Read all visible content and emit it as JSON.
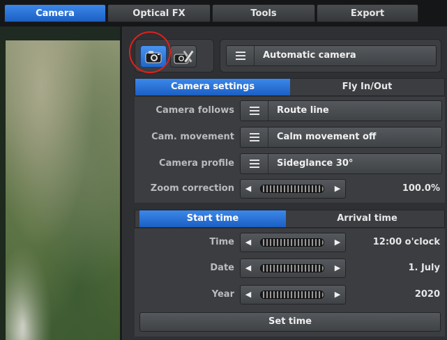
{
  "tabs": [
    {
      "label": "Camera",
      "active": true
    },
    {
      "label": "Optical FX",
      "active": false
    },
    {
      "label": "Tools",
      "active": false
    },
    {
      "label": "Export",
      "active": false
    }
  ],
  "mode_buttons": {
    "camera": {
      "icon": "camera-icon",
      "active": true
    },
    "camera_tool": {
      "icon": "camera-settings-icon",
      "active": false
    }
  },
  "automatic_camera": {
    "icon": "menu-list-icon",
    "label": "Automatic camera"
  },
  "camera_tabs": [
    {
      "label": "Camera settings",
      "active": true
    },
    {
      "label": "Fly In/Out",
      "active": false
    }
  ],
  "camera_settings": {
    "follows_label": "Camera follows",
    "follows_value": "Route line",
    "movement_label": "Cam. movement",
    "movement_value": "Calm movement off",
    "profile_label": "Camera profile",
    "profile_value": "Sideglance 30°",
    "zoom_label": "Zoom correction",
    "zoom_value": "100.0%"
  },
  "time_tabs": [
    {
      "label": "Start time",
      "active": true
    },
    {
      "label": "Arrival time",
      "active": false
    }
  ],
  "time_settings": {
    "time_label": "Time",
    "time_value": "12:00 o'clock",
    "date_label": "Date",
    "date_value": "1. July",
    "year_label": "Year",
    "year_value": "2020"
  },
  "set_time_label": "Set time",
  "colors": {
    "accent": "#2c74dc",
    "highlight_circle": "#e0201c",
    "panel_bg": "#2e3033"
  }
}
